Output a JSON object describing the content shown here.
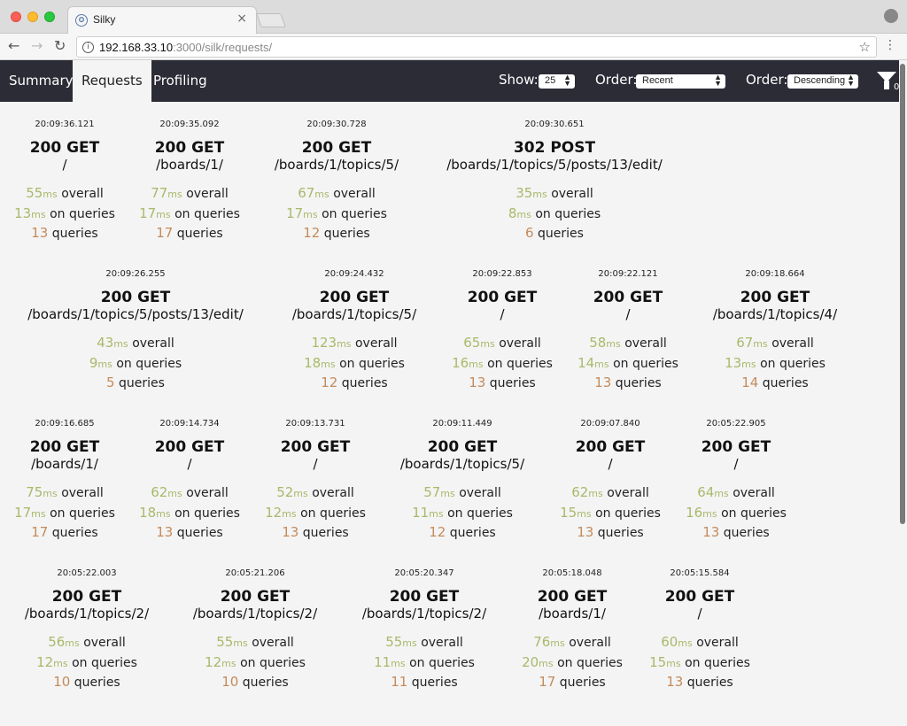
{
  "browser": {
    "tab_title": "Silky",
    "tab_close": "×",
    "favicon_glyph": "✪",
    "url_host": "192.168.33.10",
    "url_path": ":3000/silk/requests/",
    "back": "←",
    "forward": "→",
    "reload": "↻",
    "info": "i",
    "star": "☆",
    "menu": "⋮"
  },
  "nav": {
    "summary": "Summary",
    "requests": "Requests",
    "profiling": "Profiling"
  },
  "controls": {
    "show_label": "Show:",
    "show_value": "25",
    "order_by_label": "Order:",
    "order_by_value": "Recent",
    "order_dir_label": "Order:",
    "order_dir_value": "Descending",
    "filter_count": "0"
  },
  "units": {
    "ms": "ms",
    "overall": "overall",
    "on_queries": "on queries",
    "queries": "queries"
  },
  "requests": [
    {
      "time": "20:09:36.121",
      "status": "200 GET",
      "path": "/",
      "overall": "55",
      "query_time": "13",
      "queries": "13"
    },
    {
      "time": "20:09:35.092",
      "status": "200 GET",
      "path": "/boards/1/",
      "overall": "77",
      "query_time": "17",
      "queries": "17"
    },
    {
      "time": "20:09:30.728",
      "status": "200 GET",
      "path": "/boards/1/topics/5/",
      "overall": "67",
      "query_time": "17",
      "queries": "12"
    },
    {
      "time": "20:09:30.651",
      "status": "302 POST",
      "path": "/boards/1/topics/5/posts/13/edit/",
      "overall": "35",
      "query_time": "8",
      "queries": "6"
    },
    {
      "time": "20:09:26.255",
      "status": "200 GET",
      "path": "/boards/1/topics/5/posts/13/edit/",
      "overall": "43",
      "query_time": "9",
      "queries": "5"
    },
    {
      "time": "20:09:24.432",
      "status": "200 GET",
      "path": "/boards/1/topics/5/",
      "overall": "123",
      "query_time": "18",
      "queries": "12"
    },
    {
      "time": "20:09:22.853",
      "status": "200 GET",
      "path": "/",
      "overall": "65",
      "query_time": "16",
      "queries": "13"
    },
    {
      "time": "20:09:22.121",
      "status": "200 GET",
      "path": "/",
      "overall": "58",
      "query_time": "14",
      "queries": "13"
    },
    {
      "time": "20:09:18.664",
      "status": "200 GET",
      "path": "/boards/1/topics/4/",
      "overall": "67",
      "query_time": "13",
      "queries": "14"
    },
    {
      "time": "20:09:16.685",
      "status": "200 GET",
      "path": "/boards/1/",
      "overall": "75",
      "query_time": "17",
      "queries": "17"
    },
    {
      "time": "20:09:14.734",
      "status": "200 GET",
      "path": "/",
      "overall": "62",
      "query_time": "18",
      "queries": "13"
    },
    {
      "time": "20:09:13.731",
      "status": "200 GET",
      "path": "/",
      "overall": "52",
      "query_time": "12",
      "queries": "13"
    },
    {
      "time": "20:09:11.449",
      "status": "200 GET",
      "path": "/boards/1/topics/5/",
      "overall": "57",
      "query_time": "11",
      "queries": "12"
    },
    {
      "time": "20:09:07.840",
      "status": "200 GET",
      "path": "/",
      "overall": "62",
      "query_time": "15",
      "queries": "13"
    },
    {
      "time": "20:05:22.905",
      "status": "200 GET",
      "path": "/",
      "overall": "64",
      "query_time": "16",
      "queries": "13"
    },
    {
      "time": "20:05:22.003",
      "status": "200 GET",
      "path": "/boards/1/topics/2/",
      "overall": "56",
      "query_time": "12",
      "queries": "10"
    },
    {
      "time": "20:05:21.206",
      "status": "200 GET",
      "path": "/boards/1/topics/2/",
      "overall": "55",
      "query_time": "12",
      "queries": "10"
    },
    {
      "time": "20:05:20.347",
      "status": "200 GET",
      "path": "/boards/1/topics/2/",
      "overall": "55",
      "query_time": "11",
      "queries": "11"
    },
    {
      "time": "20:05:18.048",
      "status": "200 GET",
      "path": "/boards/1/",
      "overall": "76",
      "query_time": "20",
      "queries": "17"
    },
    {
      "time": "20:05:15.584",
      "status": "200 GET",
      "path": "/",
      "overall": "60",
      "query_time": "15",
      "queries": "13"
    }
  ]
}
